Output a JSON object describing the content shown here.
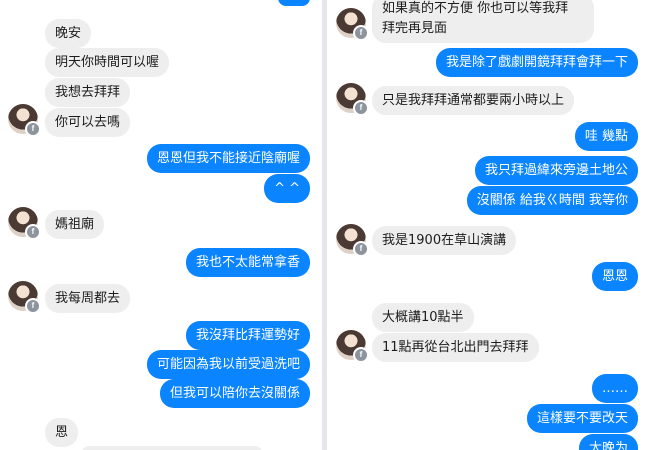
{
  "left": {
    "messages": [
      {
        "dir": "in",
        "text": "晚安"
      },
      {
        "dir": "in",
        "text": "明天你時間可以喔"
      },
      {
        "dir": "in",
        "text": "我想去拜拜"
      },
      {
        "dir": "in",
        "text": "你可以去嗎"
      },
      {
        "dir": "out",
        "text": "恩恩但我不能接近陰廟喔"
      },
      {
        "dir": "out",
        "text": "^ ^"
      },
      {
        "dir": "in",
        "text": "媽祖廟"
      },
      {
        "dir": "out",
        "text": "我也不太能常拿香"
      },
      {
        "dir": "in",
        "text": "我每周都去"
      },
      {
        "dir": "out",
        "text": "我沒拜比拜運勢好"
      },
      {
        "dir": "out",
        "text": "可能因為我以前受過洗吧"
      },
      {
        "dir": "out",
        "text": "但我可以陪你去沒關係"
      },
      {
        "dir": "in",
        "text": "恩"
      }
    ]
  },
  "right": {
    "messages": [
      {
        "dir": "in",
        "text": "如果真的不方便 你也可以等我拜"
      },
      {
        "dir": "in",
        "text": "拜完再見面"
      },
      {
        "dir": "out",
        "text": "我是除了戲劇開鏡拜拜會拜一下"
      },
      {
        "dir": "in",
        "text": "只是我拜拜通常都要兩小時以上"
      },
      {
        "dir": "out",
        "text": "哇 幾點"
      },
      {
        "dir": "out",
        "text": "我只拜過緯來旁邊土地公"
      },
      {
        "dir": "out",
        "text": "沒關係 給我ㄍ時間 我等你"
      },
      {
        "dir": "in",
        "text": "我是1900在草山演講"
      },
      {
        "dir": "out",
        "text": "恩恩"
      },
      {
        "dir": "in",
        "text": "大概講10點半"
      },
      {
        "dir": "in",
        "text": "11點再從台北出門去拜拜"
      },
      {
        "dir": "out",
        "text": "……"
      },
      {
        "dir": "out",
        "text": "這樣要不要改天"
      },
      {
        "dir": "out",
        "text": "太晚为"
      }
    ]
  },
  "colors": {
    "outgoing": "#0a84ff",
    "incoming": "#eeeeee",
    "divider": "#e4e6eb"
  },
  "icons": {
    "avatar_badge": "messenger-badge-icon"
  }
}
